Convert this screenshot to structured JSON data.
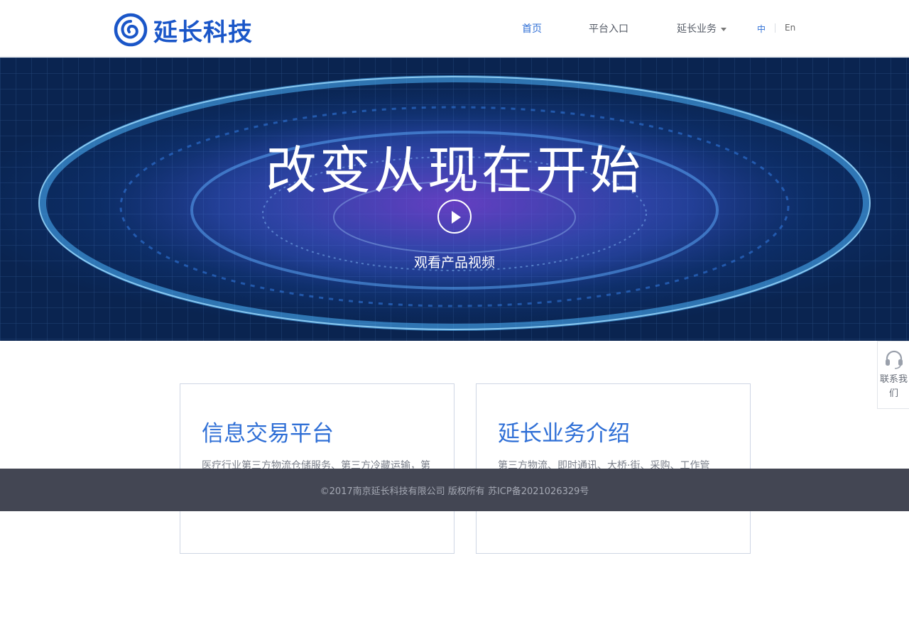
{
  "header": {
    "logo_text": "延长科技",
    "nav": [
      {
        "label": "首页",
        "active": true
      },
      {
        "label": "平台入口",
        "active": false
      },
      {
        "label": "延长业务",
        "active": false
      }
    ],
    "lang": [
      {
        "label": "中",
        "active": true
      },
      {
        "label": "En",
        "active": false
      }
    ]
  },
  "hero": {
    "title": "改变从现在开始",
    "video_label": "观看产品视频"
  },
  "cards": [
    {
      "title": "信息交易平台",
      "desc": "医疗行业第三方物流仓储服务、第三方冷藏运输，第 业、医院、药店等合作入驻。"
    },
    {
      "title": "延长业务介绍",
      "desc": "第三方物流、即时通讯、大桥·街、采购、工作管 业、机构和个人提供全方位解决方案。"
    }
  ],
  "footer": {
    "copyright": "©2017南京延长科技有限公司 版权所有  苏ICP备2021026329号"
  },
  "contact": {
    "label": "联系我们",
    "icon": "headset-icon"
  },
  "colors": {
    "accent": "#2f6fd6",
    "logo": "#1a56c8",
    "footer_bg": "#434653"
  }
}
